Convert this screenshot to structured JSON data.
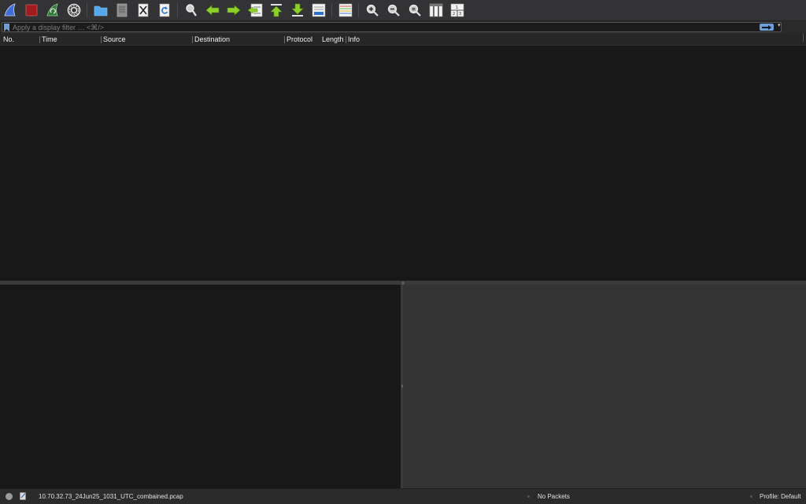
{
  "toolbar": {
    "buttons": [
      {
        "id": "start-capture",
        "icon": "shark-fin-icon"
      },
      {
        "id": "stop-capture",
        "icon": "stop-square-icon"
      },
      {
        "id": "restart-capture",
        "icon": "restart-fin-icon"
      },
      {
        "id": "capture-options",
        "icon": "gear-icon"
      },
      {
        "id": "open-file",
        "icon": "folder-icon"
      },
      {
        "id": "save-file",
        "icon": "document-icon"
      },
      {
        "id": "close-file",
        "icon": "close-file-icon"
      },
      {
        "id": "reload-file",
        "icon": "reload-icon"
      },
      {
        "id": "find-packet",
        "icon": "magnifier-icon"
      },
      {
        "id": "go-back",
        "icon": "arrow-left-icon"
      },
      {
        "id": "go-forward",
        "icon": "arrow-right-icon"
      },
      {
        "id": "go-to-packet",
        "icon": "jump-to-packet-icon"
      },
      {
        "id": "first-packet",
        "icon": "arrow-up-bar-icon"
      },
      {
        "id": "last-packet",
        "icon": "arrow-down-bar-icon"
      },
      {
        "id": "autoscroll",
        "icon": "autoscroll-icon"
      },
      {
        "id": "colorize",
        "icon": "colorize-lines-icon"
      },
      {
        "id": "zoom-in",
        "icon": "zoom-in-icon"
      },
      {
        "id": "zoom-out",
        "icon": "zoom-out-icon"
      },
      {
        "id": "normal-size",
        "icon": "zoom-normal-icon"
      },
      {
        "id": "resize-columns",
        "icon": "resize-columns-icon"
      },
      {
        "id": "layout-panes",
        "icon": "layout-icon"
      }
    ]
  },
  "filter": {
    "placeholder": "Apply a display filter … <⌘/>",
    "value": "",
    "add_label": "+"
  },
  "packet_list": {
    "columns": [
      "No.",
      "Time",
      "Source",
      "Destination",
      "Protocol",
      "Length",
      "Info"
    ]
  },
  "status": {
    "file": "10.70.32.73_24Jun25_1031_UTC_combained.pcap",
    "packets": "No Packets",
    "profile": "Profile: Default"
  },
  "colors": {
    "accent": "#6d9fd6",
    "pane_dark": "#181818",
    "pane_gray": "#333333"
  }
}
